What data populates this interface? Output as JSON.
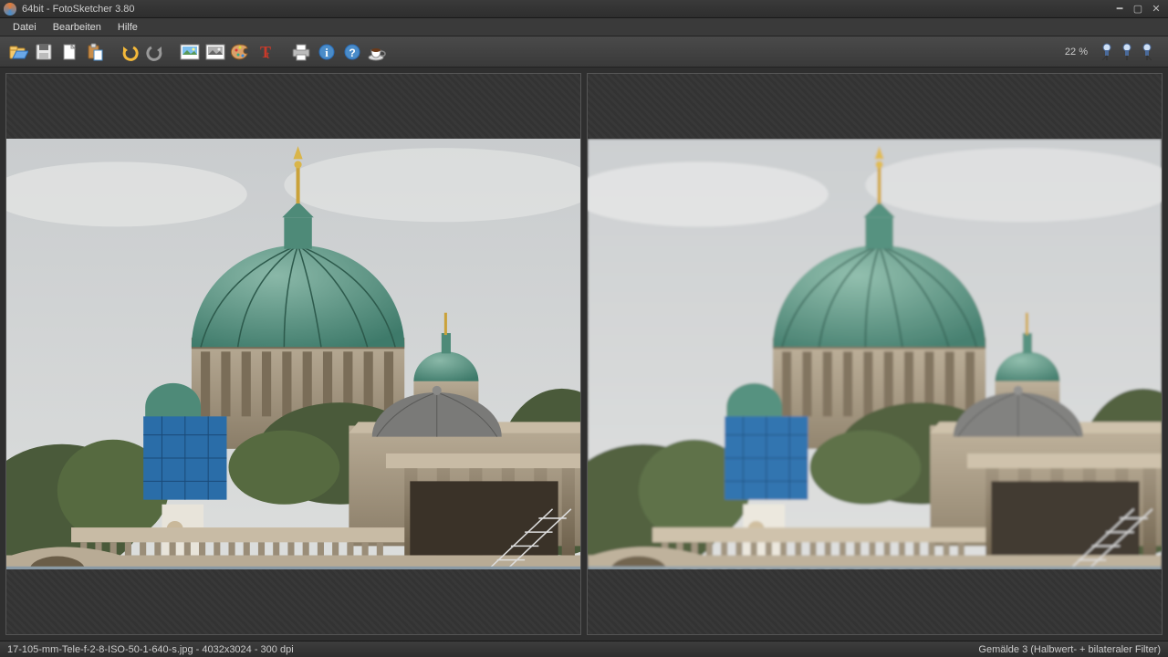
{
  "titlebar": {
    "text": "64bit - FotoSketcher 3.80"
  },
  "menu": {
    "file": "Datei",
    "edit": "Bearbeiten",
    "help": "Hilfe"
  },
  "toolbar": {
    "icons": [
      "open",
      "save",
      "new",
      "paste",
      "undo",
      "redo",
      "image-src",
      "image-out",
      "palette",
      "text",
      "print",
      "info",
      "help",
      "coffee"
    ],
    "zoom_label": "22 %"
  },
  "status": {
    "left": "17-105-mm-Tele-f-2-8-ISO-50-1-640-s.jpg - 4032x3024 - 300 dpi",
    "right": "Gemälde 3 (Halbwert- + bilateraler Filter)"
  }
}
